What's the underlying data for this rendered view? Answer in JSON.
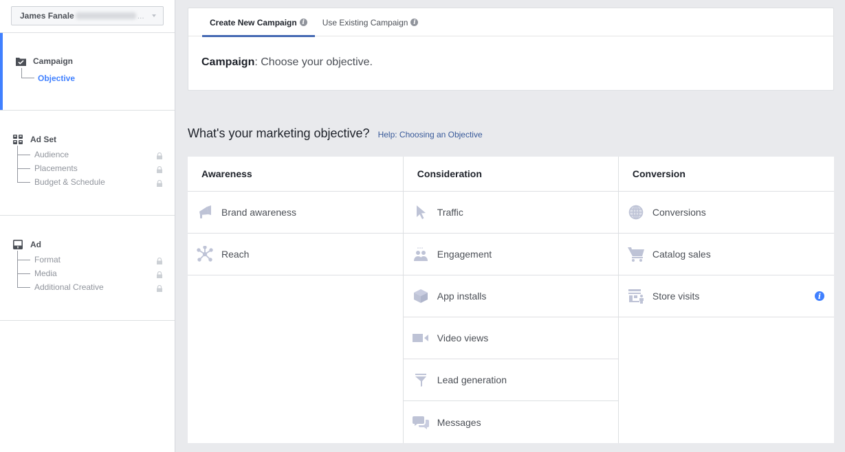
{
  "sidebar": {
    "account": {
      "name": "James Fanale",
      "id_redacted": true,
      "ellipsis": "..."
    },
    "sections": [
      {
        "title": "Campaign",
        "icon": "checkbox-folder-icon",
        "active": true,
        "items": [
          {
            "label": "Objective",
            "active": true,
            "locked": false
          }
        ]
      },
      {
        "title": "Ad Set",
        "icon": "grid-icon",
        "active": false,
        "items": [
          {
            "label": "Audience",
            "locked": true
          },
          {
            "label": "Placements",
            "locked": true
          },
          {
            "label": "Budget & Schedule",
            "locked": true
          }
        ]
      },
      {
        "title": "Ad",
        "icon": "ad-layout-icon",
        "active": false,
        "items": [
          {
            "label": "Format",
            "locked": true
          },
          {
            "label": "Media",
            "locked": true
          },
          {
            "label": "Additional Creative",
            "locked": true
          }
        ]
      }
    ]
  },
  "top_panel": {
    "tabs": [
      {
        "label": "Create New Campaign",
        "active": true
      },
      {
        "label": "Use Existing Campaign",
        "active": false
      }
    ],
    "campaign_label": "Campaign",
    "campaign_text": ": Choose your objective."
  },
  "objective": {
    "heading": "What's your marketing objective?",
    "help_link": "Help: Choosing an Objective",
    "columns": [
      {
        "title": "Awareness",
        "items": [
          {
            "label": "Brand awareness",
            "icon": "megaphone-icon"
          },
          {
            "label": "Reach",
            "icon": "reach-network-icon"
          }
        ]
      },
      {
        "title": "Consideration",
        "items": [
          {
            "label": "Traffic",
            "icon": "cursor-icon"
          },
          {
            "label": "Engagement",
            "icon": "people-icon"
          },
          {
            "label": "App installs",
            "icon": "box-icon"
          },
          {
            "label": "Video views",
            "icon": "video-camera-icon"
          },
          {
            "label": "Lead generation",
            "icon": "funnel-icon"
          },
          {
            "label": "Messages",
            "icon": "chat-bubbles-icon"
          }
        ]
      },
      {
        "title": "Conversion",
        "items": [
          {
            "label": "Conversions",
            "icon": "globe-icon"
          },
          {
            "label": "Catalog sales",
            "icon": "cart-icon"
          },
          {
            "label": "Store visits",
            "icon": "store-icon",
            "info": true
          }
        ]
      }
    ]
  },
  "colors": {
    "accent_blue": "#4080ff",
    "tab_underline": "#4267b2",
    "link": "#365899",
    "icon_muted": "#bec3d6",
    "background": "#e9eaed"
  }
}
